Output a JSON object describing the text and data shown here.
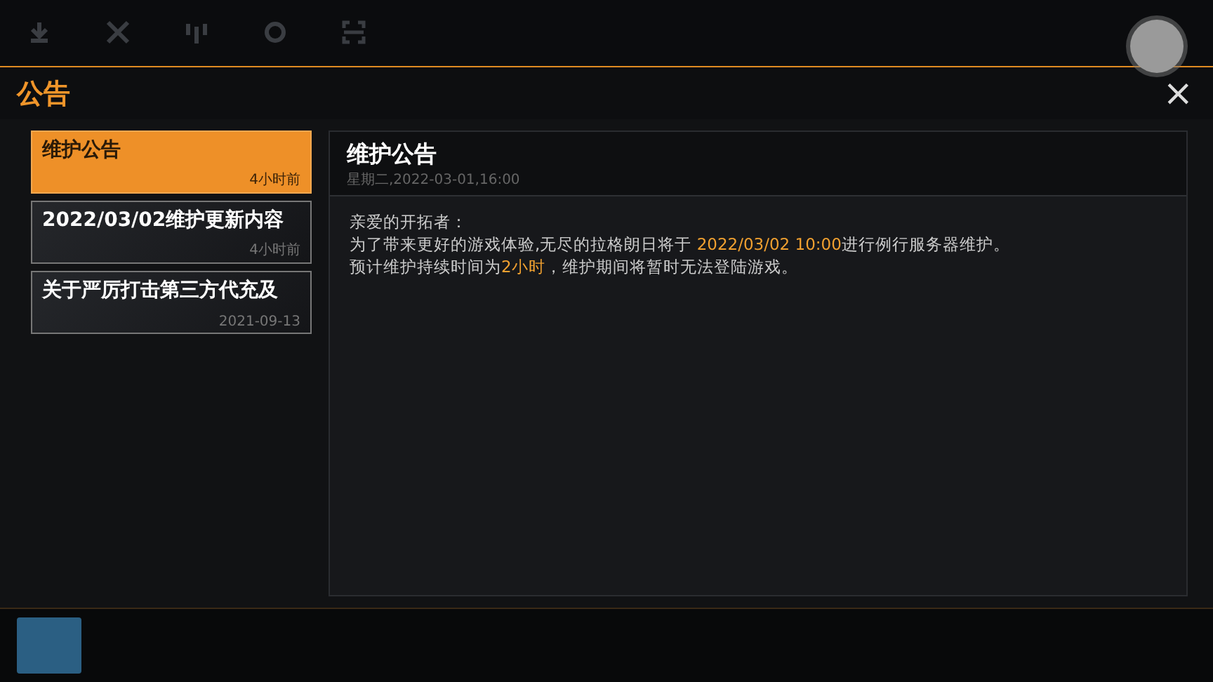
{
  "header": {
    "title": "公告",
    "close": "×"
  },
  "announcements": [
    {
      "title": "维护公告",
      "time": "4小时前",
      "selected": true
    },
    {
      "title": "2022/03/02维护更新内容",
      "time": "4小时前",
      "selected": false
    },
    {
      "title": "关于严厉打击第三方代充及",
      "time": "2021-09-13",
      "selected": false
    }
  ],
  "detail": {
    "title": "维护公告",
    "date": "星期二,2022-03-01,16:00",
    "lines": [
      [
        {
          "text": "亲爱的开拓者：",
          "highlight": false
        }
      ],
      [
        {
          "text": "为了带来更好的游戏体验,无尽的拉格朗日将于 ",
          "highlight": false
        },
        {
          "text": "2022/03/02 10:00",
          "highlight": true
        },
        {
          "text": "进行例行服务器维护。",
          "highlight": false
        }
      ],
      [
        {
          "text": "预计维护持续时间为",
          "highlight": false
        },
        {
          "text": "2小时",
          "highlight": true
        },
        {
          "text": "，维护期间将暂时无法登陆游戏。",
          "highlight": false
        }
      ]
    ]
  }
}
